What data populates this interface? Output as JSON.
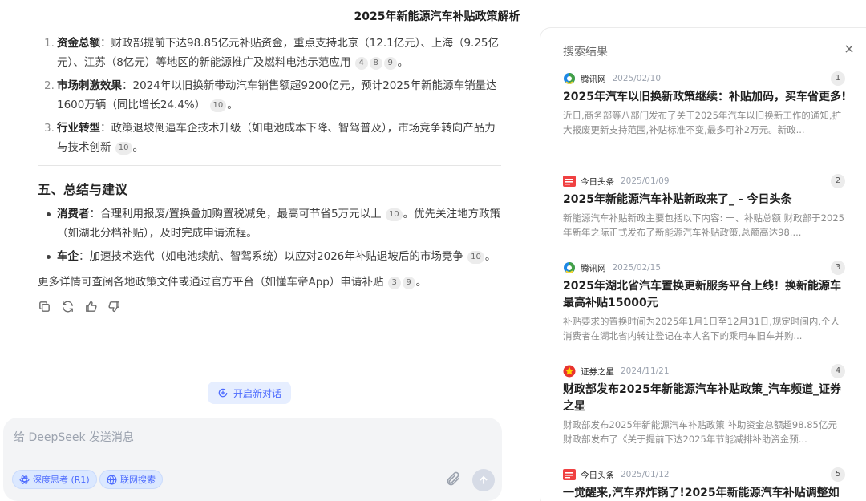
{
  "page": {
    "title": "2025年新能源汽车补贴政策解析"
  },
  "answer": {
    "items": [
      {
        "num": "1.",
        "label": "资金总额",
        "text": "：财政部提前下达98.85亿元补贴资金，重点支持北京（12.1亿元）、上海（9.25亿元）、江苏（8亿元）等地区的新能源推广及燃料电池示范应用",
        "cites": [
          "4",
          "8",
          "9"
        ],
        "tail": "。"
      },
      {
        "num": "2.",
        "label": "市场刺激效果",
        "text": "：2024年以旧换新带动汽车销售额超9200亿元，预计2025年新能源车销量达1600万辆（同比增长24.4%）",
        "cites": [
          "10"
        ],
        "tail": "。"
      },
      {
        "num": "3.",
        "label": "行业转型",
        "text": "：政策退坡倒逼车企技术升级（如电池成本下降、智驾普及），市场竞争转向产品力与技术创新",
        "cites": [
          "10"
        ],
        "tail": "。"
      }
    ],
    "section_title": "五、总结与建议",
    "bullets": [
      {
        "label": "消费者",
        "text": "：合理利用报废/置换叠加购置税减免，最高可节省5万元以上",
        "cites": [
          "10"
        ],
        "tail": "。优先关注地方政策（如湖北分档补贴），及时完成申请流程。"
      },
      {
        "label": "车企",
        "text": "：加速技术迭代（如电池续航、智驾系统）以应对2026年补贴退坡后的市场竞争",
        "cites": [
          "10"
        ],
        "tail": "。"
      }
    ],
    "closing": "更多详情可查阅各地政策文件或通过官方平台（如懂车帝App）申请补贴",
    "closing_cites": [
      "3",
      "9"
    ],
    "closing_tail": "。"
  },
  "new_chat_label": "开启新对话",
  "input": {
    "placeholder": "给 DeepSeek 发送消息",
    "deep_think_label": "深度思考 (R1)",
    "web_search_label": "联网搜索"
  },
  "panel": {
    "title": "搜索结果",
    "results": [
      {
        "index": "1",
        "source": "腾讯网",
        "source_icon": "tencent-news-icon",
        "date": "2025/02/10",
        "title": "2025年汽车以旧换新政策继续：补贴加码，买车省更多!",
        "snippet": "近日,商务部等八部门发布了关于2025年汽车以旧换新工作的通知,扩大报废更新支持范围,补贴标准不变,最多可补2万元。新政..."
      },
      {
        "index": "2",
        "source": "今日头条",
        "source_icon": "toutiao-icon",
        "date": "2025/01/09",
        "title": "2025年新能源汽车补贴新政来了_ - 今日头条",
        "snippet": "新能源汽车补贴新政主要包括以下内容: 一、补贴总额 财政部于2025年新年之际正式发布了新能源汽车补贴政策,总额高达98...."
      },
      {
        "index": "3",
        "source": "腾讯网",
        "source_icon": "tencent-news-icon",
        "date": "2025/02/15",
        "title": "2025年湖北省汽车置换更新服务平台上线！换新能源车最高补贴15000元",
        "snippet": "补贴要求的置换时间为2025年1月1日至12月31日,规定时间内,个人消费者在湖北省内转让登记在本人名下的乘用车旧车并购..."
      },
      {
        "index": "4",
        "source": "证券之星",
        "source_icon": "stockstar-icon",
        "date": "2024/11/21",
        "title": "财政部发布2025年新能源汽车补贴政策_汽车频道_证券之星",
        "snippet": "财政部发布2025年新能源汽车补贴政策 补助资金总额超98.85亿元 财政部发布了《关于提前下达2025年节能减排补助资金预..."
      },
      {
        "index": "5",
        "source": "今日头条",
        "source_icon": "toutiao-icon",
        "date": "2025/01/12",
        "title": "一觉醒来,汽车界炸锅了!2025年新能源汽车补贴调整如",
        "snippet": ""
      }
    ]
  },
  "colors": {
    "accent": "#4d6bfe",
    "pill_bg": "#dbe8ff",
    "input_bg": "#f3f4f6",
    "toutiao_red": "#f04142",
    "stockstar_red": "#e8332e"
  }
}
